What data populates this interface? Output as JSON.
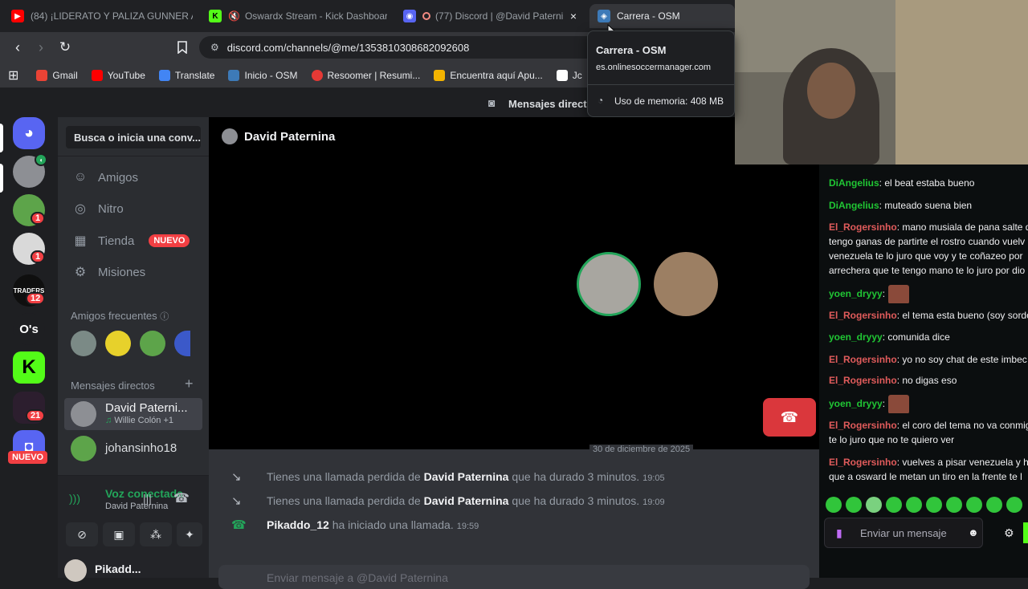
{
  "tabs": [
    {
      "label": "(84) ¡LIDERATO Y PALIZA GUNNER A!",
      "favicon": "youtube-icon"
    },
    {
      "label": "Oswardx Stream - Kick Dashboard",
      "favicon": "kick-icon"
    },
    {
      "label": "(77) Discord | @David Paterni",
      "favicon": "discord-icon"
    },
    {
      "label": "Carrera - OSM",
      "favicon": "osm-icon"
    }
  ],
  "tab_close": "×",
  "address": "discord.com/channels/@me/1353810308682092608",
  "bookmarks": [
    "Gmail",
    "YouTube",
    "Translate",
    "Inicio - OSM",
    "Resoomer | Resumi...",
    "Encuentra aquí Apu...",
    "Jc"
  ],
  "tooltip": {
    "title": "Carrera - OSM",
    "url": "es.onlinesoccermanager.com",
    "memory": "Uso de memoria: 408 MB"
  },
  "topbar": {
    "title": "Mensajes directo"
  },
  "servers": {
    "badges": [
      "1",
      "1",
      "12",
      "21"
    ],
    "labels": [
      "TRADERS",
      "O's"
    ],
    "new_badge": "NUEVO"
  },
  "sidebar": {
    "search": "Busca o inicia una conv...",
    "nav": [
      {
        "label": "Amigos",
        "icon": "friends-icon"
      },
      {
        "label": "Nitro",
        "icon": "nitro-icon"
      },
      {
        "label": "Tienda",
        "icon": "shop-icon"
      },
      {
        "label": "Misiones",
        "icon": "quest-icon"
      }
    ],
    "new_badge": "NUEVO",
    "frequent_header": "Amigos frecuentes",
    "dm_header": "Mensajes directos",
    "dm_add": "+",
    "dms": [
      {
        "name": "David Paterni...",
        "status": "Willie Colón +1"
      },
      {
        "name": "johansinho18",
        "status": ""
      }
    ]
  },
  "voice": {
    "title": "Voz conectada",
    "subtitle": "David Paternina"
  },
  "user": {
    "name": "Pikadd..."
  },
  "call": {
    "header": "David Paternina",
    "date": "30 de diciembre de 2025"
  },
  "messages": [
    {
      "prefix": "Tienes una llamada perdida de ",
      "name": "David Paternina",
      "suffix": " que ha durado 3 minutos.",
      "time": "19:05",
      "icon": "missed-call-icon"
    },
    {
      "prefix": "Tienes una llamada perdida de ",
      "name": "David Paternina",
      "suffix": " que ha durado 3 minutos.",
      "time": "19:09",
      "icon": "missed-call-icon"
    },
    {
      "prefix": "",
      "name": "Pikaddo_12",
      "suffix": " ha iniciado una llamada.",
      "time": "19:59",
      "icon": "call-icon"
    }
  ],
  "composer_placeholder": "Enviar mensaje a @David Paternina",
  "chat": {
    "lines": [
      {
        "user": "DiAngelius",
        "text": ": el beat estaba bueno",
        "color": "green"
      },
      {
        "user": "DiAngelius",
        "text": ": muteado suena bien",
        "color": "green"
      },
      {
        "user": "El_Rogersinho",
        "text": ": mano musiala de pana salte d",
        "color": "red"
      },
      {
        "user": "",
        "text": "tengo ganas de partirte el rostro cuando vuelv",
        "color": ""
      },
      {
        "user": "",
        "text": "venezuela te lo juro que voy y te coñazeo por",
        "color": ""
      },
      {
        "user": "",
        "text": "arrechera que te tengo mano te lo juro por dio",
        "color": ""
      },
      {
        "user": "yoen_dryyy",
        "text": ":",
        "color": "green"
      },
      {
        "user": "El_Rogersinho",
        "text": ": el tema esta bueno (soy sordo",
        "color": "red"
      },
      {
        "user": "yoen_dryyy",
        "text": ": comunida dice",
        "color": "green"
      },
      {
        "user": "El_Rogersinho",
        "text": ": yo no soy chat de este imbec",
        "color": "red"
      },
      {
        "user": "El_Rogersinho",
        "text": ": no digas eso",
        "color": "red"
      },
      {
        "user": "yoen_dryyy",
        "text": ":",
        "color": "green"
      },
      {
        "user": "El_Rogersinho",
        "text": ": el coro del tema no va conmig",
        "color": "red"
      },
      {
        "user": "",
        "text": "te lo juro que no te quiero ver",
        "color": ""
      },
      {
        "user": "El_Rogersinho",
        "text": ": vuelves a pisar venezuela y h",
        "color": "red"
      },
      {
        "user": "",
        "text": "que a osward le metan un tiro en la frente te l",
        "color": ""
      }
    ],
    "input_placeholder": "Enviar un mensaje"
  }
}
